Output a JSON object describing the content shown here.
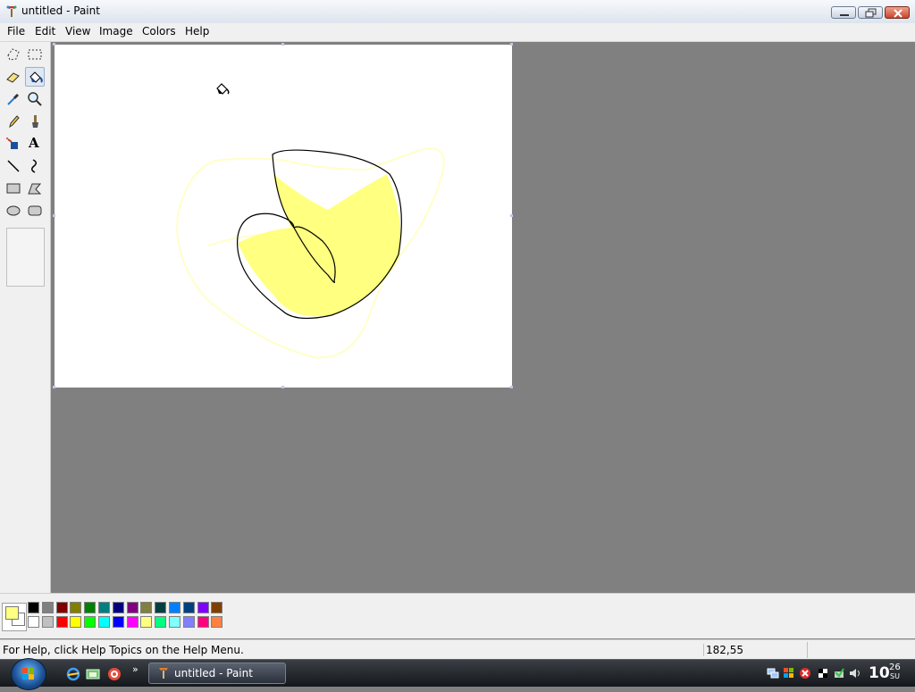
{
  "window": {
    "title": "untitled - Paint"
  },
  "menu": {
    "items": [
      "File",
      "Edit",
      "View",
      "Image",
      "Colors",
      "Help"
    ]
  },
  "toolbox": {
    "tools": [
      {
        "name": "free-form-select",
        "icon": "free-form-select-icon",
        "selected": false
      },
      {
        "name": "select",
        "icon": "select-icon",
        "selected": false
      },
      {
        "name": "eraser",
        "icon": "eraser-icon",
        "selected": false
      },
      {
        "name": "fill-with-color",
        "icon": "paint-bucket-icon",
        "selected": true
      },
      {
        "name": "pick-color",
        "icon": "eyedropper-icon",
        "selected": false
      },
      {
        "name": "magnifier",
        "icon": "magnifier-icon",
        "selected": false
      },
      {
        "name": "pencil",
        "icon": "pencil-icon",
        "selected": false
      },
      {
        "name": "brush",
        "icon": "brush-icon",
        "selected": false
      },
      {
        "name": "airbrush",
        "icon": "airbrush-icon",
        "selected": false
      },
      {
        "name": "text",
        "icon": "text-icon",
        "selected": false
      },
      {
        "name": "line",
        "icon": "line-icon",
        "selected": false
      },
      {
        "name": "curve",
        "icon": "curve-icon",
        "selected": false
      },
      {
        "name": "rectangle",
        "icon": "rectangle-icon",
        "selected": false
      },
      {
        "name": "polygon",
        "icon": "polygon-icon",
        "selected": false
      },
      {
        "name": "ellipse",
        "icon": "ellipse-icon",
        "selected": false
      },
      {
        "name": "rounded-rectangle",
        "icon": "rounded-rectangle-icon",
        "selected": false
      }
    ],
    "text_tool_glyph": "A"
  },
  "palette": {
    "foreground": "#ffff80",
    "background": "#ffffff",
    "top_row": [
      "#000000",
      "#808080",
      "#800000",
      "#808000",
      "#008000",
      "#008080",
      "#000080",
      "#800080",
      "#808040",
      "#004040",
      "#0080ff",
      "#004080",
      "#8000ff",
      "#804000"
    ],
    "bottom_row": [
      "#ffffff",
      "#c0c0c0",
      "#ff0000",
      "#ffff00",
      "#00ff00",
      "#00ffff",
      "#0000ff",
      "#ff00ff",
      "#ffff80",
      "#00ff80",
      "#80ffff",
      "#8080ff",
      "#ff0080",
      "#ff8040"
    ]
  },
  "status": {
    "help_text": "For Help, click Help Topics on the Help Menu.",
    "coordinates": "182,55"
  },
  "taskbar": {
    "task_label": "untitled - Paint",
    "chevron": "»",
    "clock_hour": "10",
    "clock_minute": "26",
    "clock_day": "SU"
  },
  "colors": {
    "stroke": "#000000",
    "fill_yellow": "#ffff80",
    "faint_yellow": "#ffffc8"
  }
}
